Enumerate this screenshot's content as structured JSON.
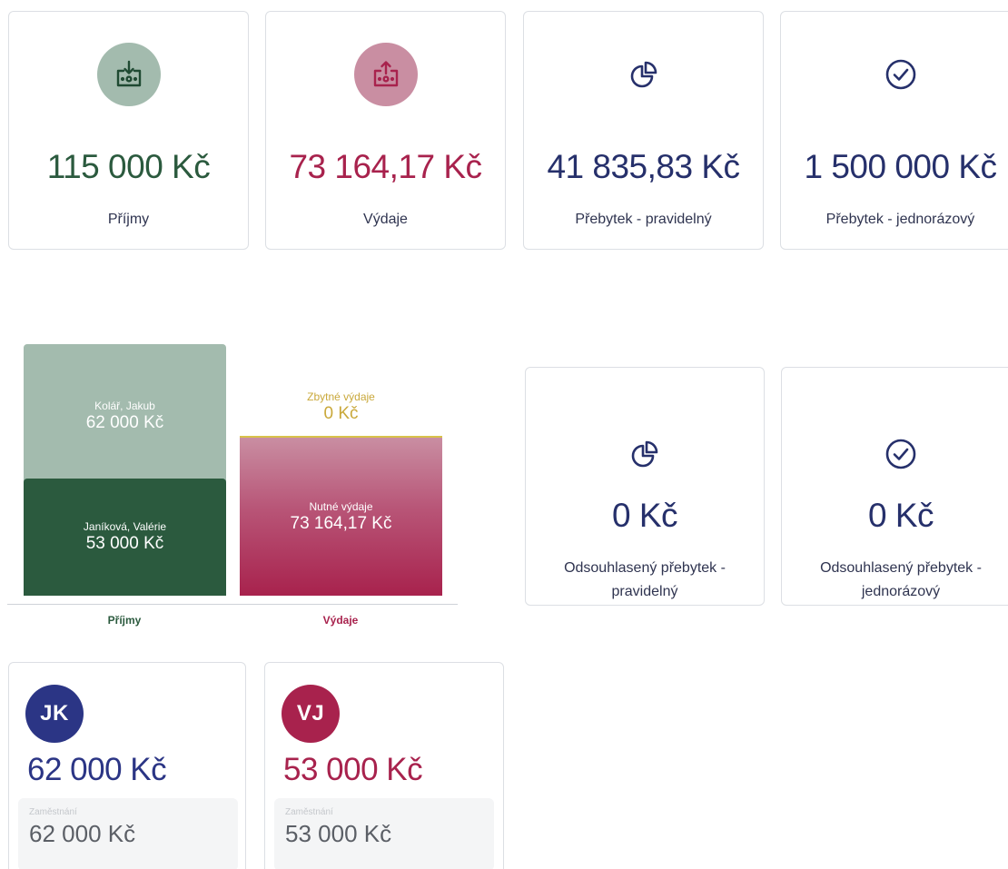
{
  "colors": {
    "income_green": "#2b5a3e",
    "income_green_light": "#a3bbae",
    "expense_red": "#a8224d",
    "expense_pink": "#c98ea2",
    "navy": "#26306b",
    "yellow": "#c9a83a"
  },
  "summary": [
    {
      "amount": "115 000 Kč",
      "label": "Příjmy",
      "icon": "income-download-icon"
    },
    {
      "amount": "73 164,17 Kč",
      "label": "Výdaje",
      "icon": "expense-upload-icon"
    },
    {
      "amount": "41 835,83 Kč",
      "label": "Přebytek - pravidelný",
      "icon": "pie-chart-icon"
    },
    {
      "amount": "1 500 000 Kč",
      "label": "Přebytek - jednorázový",
      "icon": "check-circle-icon"
    }
  ],
  "approved": [
    {
      "amount": "0 Kč",
      "label": "Odsouhlasený přebytek - pravidelný",
      "icon": "pie-chart-icon"
    },
    {
      "amount": "0 Kč",
      "label": "Odsouhlasený přebytek - jednorázový",
      "icon": "check-circle-icon"
    }
  ],
  "chart_data": {
    "type": "bar",
    "categories": [
      "Příjmy",
      "Výdaje"
    ],
    "stacks": [
      {
        "category": "Příjmy",
        "segments": [
          {
            "name": "Janíková, Valérie",
            "value": 53000,
            "label": "53 000 Kč",
            "color": "#2b5a3e"
          },
          {
            "name": "Kolář, Jakub",
            "value": 62000,
            "label": "62 000 Kč",
            "color": "#a3bbae"
          }
        ]
      },
      {
        "category": "Výdaje",
        "segments": [
          {
            "name": "Nutné výdaje",
            "value": 73164.17,
            "label": "73 164,17 Kč",
            "color": "#a8224d"
          },
          {
            "name": "Zbytné výdaje",
            "value": 0,
            "label": "0 Kč",
            "color": "#d8c24a"
          }
        ]
      }
    ],
    "ylim": [
      0,
      115000
    ]
  },
  "persons": [
    {
      "initials": "JK",
      "amount": "62 000 Kč",
      "source_label": "Zaměstnání",
      "source_amount": "62 000 Kč",
      "color": "#2b3585"
    },
    {
      "initials": "VJ",
      "amount": "53 000 Kč",
      "source_label": "Zaměstnání",
      "source_amount": "53 000 Kč",
      "color": "#a8224d"
    }
  ]
}
